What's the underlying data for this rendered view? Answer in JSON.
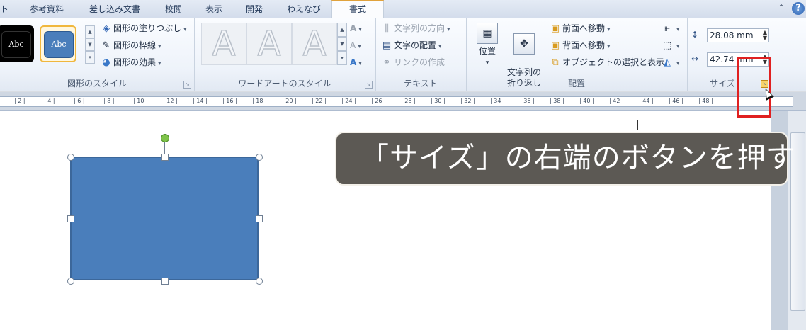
{
  "tabs": [
    {
      "label": "ト",
      "active": false
    },
    {
      "label": "参考資料",
      "active": false
    },
    {
      "label": "差し込み文書",
      "active": false
    },
    {
      "label": "校閲",
      "active": false
    },
    {
      "label": "表示",
      "active": false
    },
    {
      "label": "開発",
      "active": false
    },
    {
      "label": "わえなび",
      "active": false
    },
    {
      "label": "書式",
      "active": true
    }
  ],
  "window_controls": {
    "minimize_ribbon": "⌃",
    "help": "?"
  },
  "shape_styles": {
    "group_label": "図形のスタイル",
    "presets": [
      "Abc",
      "Abc"
    ],
    "commands": [
      {
        "icon": "paint-bucket-icon",
        "label": "図形の塗りつぶし"
      },
      {
        "icon": "pencil-icon",
        "label": "図形の枠線"
      },
      {
        "icon": "shape-effects-icon",
        "label": "図形の効果"
      }
    ]
  },
  "wordart_styles": {
    "group_label": "ワードアートのスタイル",
    "samples": [
      "A",
      "A",
      "A"
    ],
    "side_tools": [
      "A",
      "A",
      "A"
    ]
  },
  "text": {
    "group_label": "テキスト",
    "commands": [
      {
        "label": "文字列の方向",
        "enabled": false
      },
      {
        "label": "文字の配置",
        "enabled": true
      },
      {
        "label": "リンクの作成",
        "enabled": false
      }
    ]
  },
  "arrange": {
    "group_label": "配置",
    "position_label": "位置",
    "wrap_label": "文字列の\n折り返し",
    "commands": [
      {
        "label": "前面へ移動"
      },
      {
        "label": "背面へ移動"
      },
      {
        "label": "オブジェクトの選択と表示"
      }
    ]
  },
  "size": {
    "group_label": "サイズ",
    "height": "28.08 mm",
    "width": "42.74 mm"
  },
  "ruler_ticks": [
    "2",
    "4",
    "6",
    "8",
    "10",
    "12",
    "14",
    "16",
    "18",
    "20",
    "22",
    "24",
    "26",
    "28",
    "30",
    "32",
    "34",
    "36",
    "38",
    "40",
    "42",
    "44",
    "46",
    "48"
  ],
  "caption": "「サイズ」の右端のボタンを押す",
  "colors": {
    "shape_fill": "#4a7ebb",
    "highlight": "#e02020",
    "active_tab_accent": "#e0a23c"
  }
}
